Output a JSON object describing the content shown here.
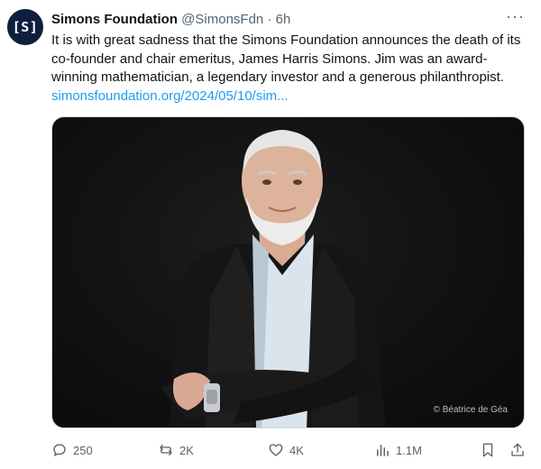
{
  "account": {
    "avatar_text": "[S]",
    "name": "Simons Foundation",
    "handle": "@SimonsFdn",
    "separator": "·",
    "time": "6h"
  },
  "more_label": "···",
  "tweet": {
    "text": "It is with great sadness that the Simons Foundation announces the death of its co-founder and chair emeritus, James Harris Simons. Jim was an award-winning mathematician, a legendary investor and a generous philanthropist. ",
    "link": "simonsfoundation.org/2024/05/10/sim..."
  },
  "media": {
    "credit": "© Béatrice de Géa"
  },
  "actions": {
    "replies": "250",
    "reposts": "2K",
    "likes": "4K",
    "views": "1.1M"
  },
  "colors": {
    "link": "#1d9bf0",
    "secondary_text": "#536471"
  },
  "icons": [
    "reply-icon",
    "repost-icon",
    "like-icon",
    "views-icon",
    "bookmark-icon",
    "share-icon"
  ]
}
